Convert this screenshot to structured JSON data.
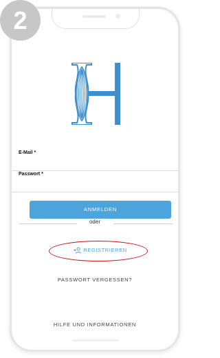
{
  "step_badge": "2",
  "form": {
    "email_label": "E-Mail *",
    "password_label": "Passwort *",
    "email_value": "",
    "password_value": ""
  },
  "actions": {
    "login_label": "ANMELDEN",
    "or_label": "oder",
    "register_label": "REGISTRIEREN",
    "forgot_password_label": "PASSWORT VERGESSEN?",
    "help_label": "HILFE UND INFORMATIONEN"
  },
  "icons": {
    "logo": "hermes-h-logo-icon",
    "register": "add-user-icon"
  },
  "colors": {
    "accent": "#4da3dc",
    "highlight": "#c8141c",
    "badge": "#c7c7c7"
  }
}
